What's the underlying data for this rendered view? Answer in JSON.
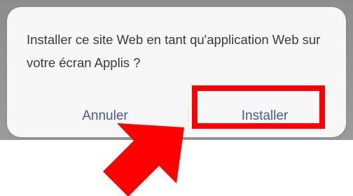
{
  "dialog": {
    "message": "Installer ce site Web en tant qu'application Web sur votre écran Applis ?",
    "cancel_label": "Annuler",
    "install_label": "Installer"
  },
  "colors": {
    "button_text": "#4d5694",
    "highlight": "#ff0000",
    "arrow": "#ff0000"
  }
}
